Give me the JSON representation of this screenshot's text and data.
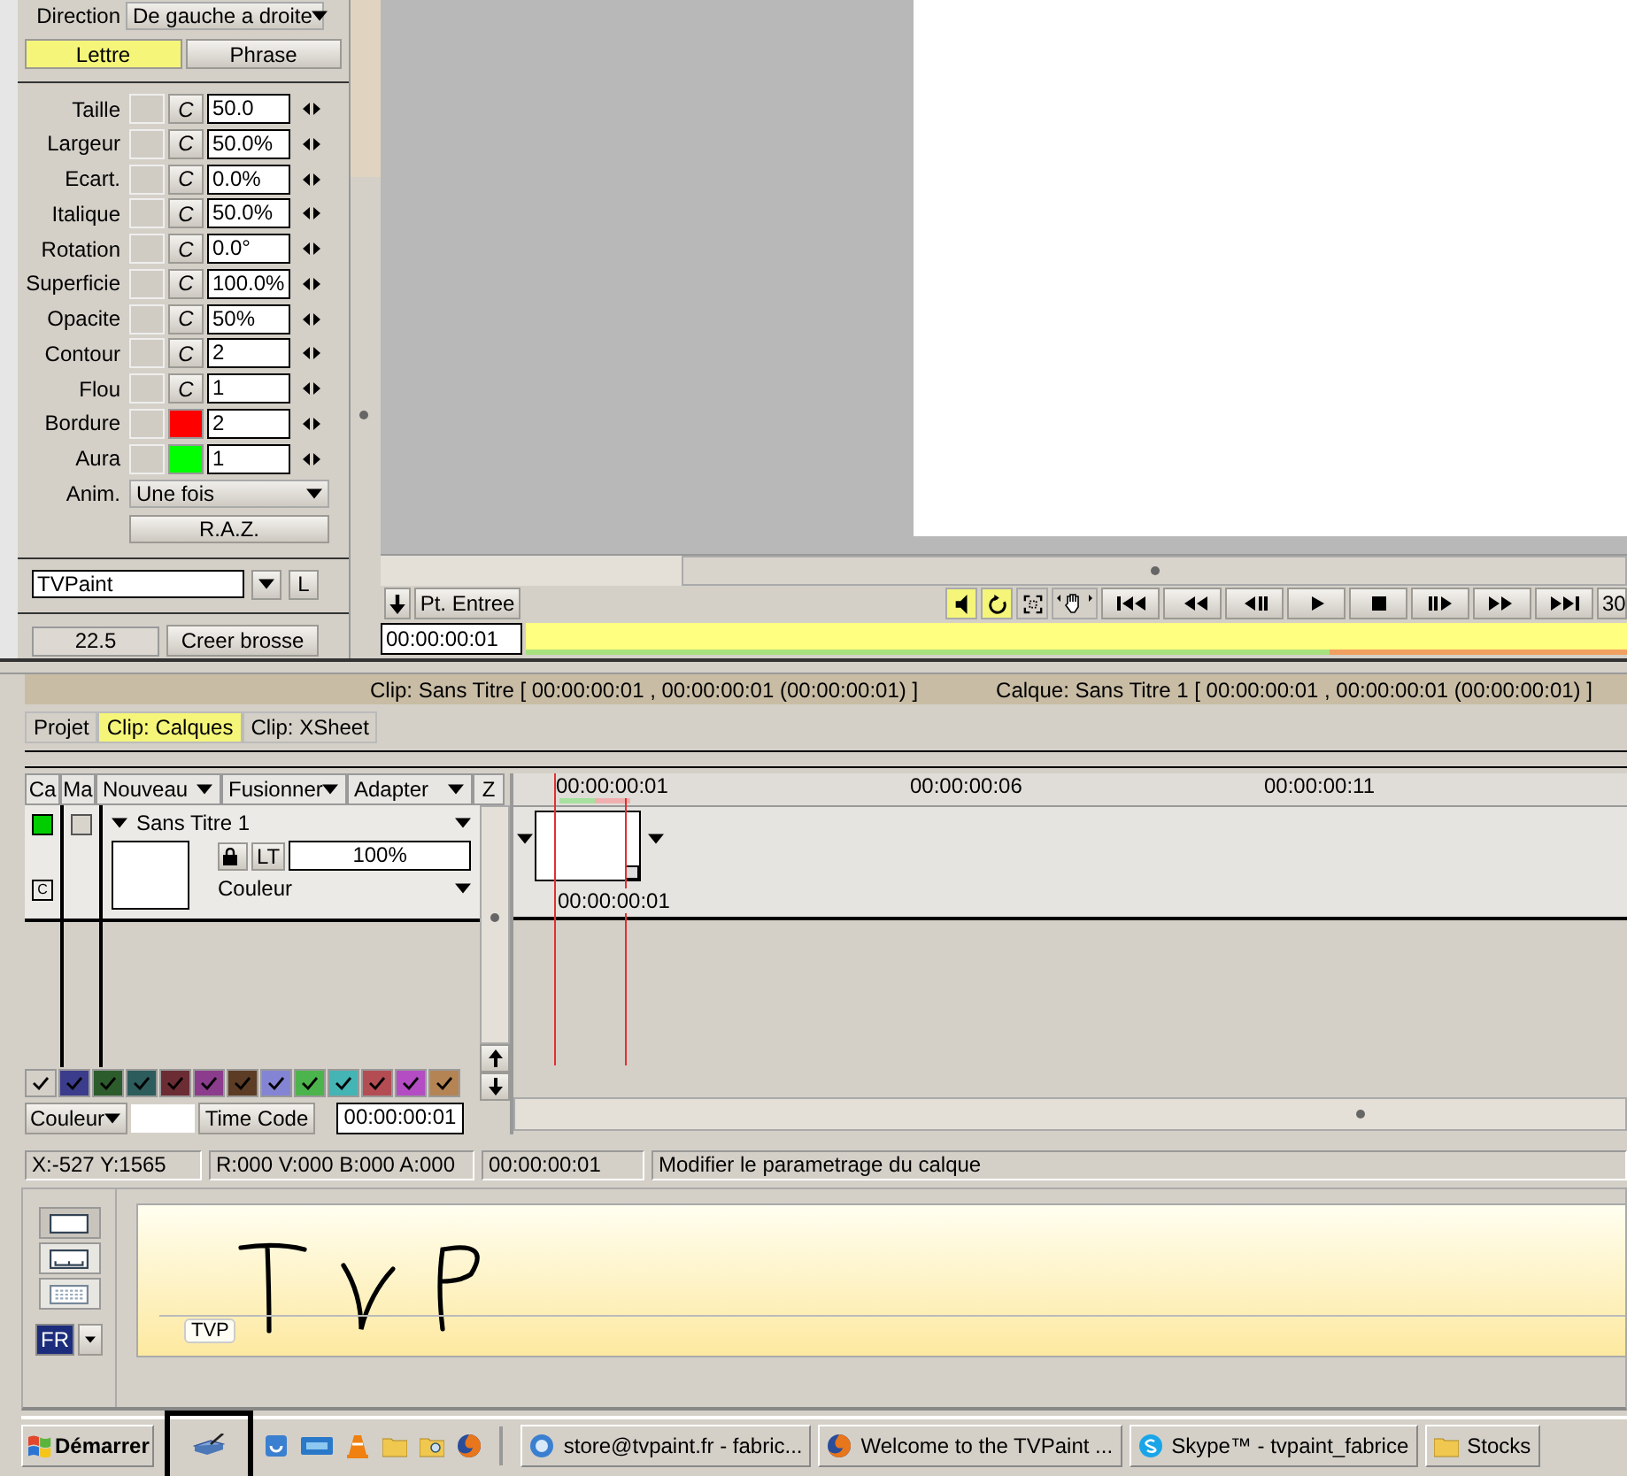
{
  "text_panel": {
    "direction_label": "Direction",
    "direction_value": "De gauche a droite",
    "modes": [
      {
        "label": "Lettre",
        "selected": true
      },
      {
        "label": "Phrase",
        "selected": false
      }
    ],
    "params": [
      {
        "label": "Taille",
        "kind": "reset",
        "reset": "C",
        "value": "50.0"
      },
      {
        "label": "Largeur",
        "kind": "reset",
        "reset": "C",
        "value": "50.0%"
      },
      {
        "label": "Ecart.",
        "kind": "reset",
        "reset": "C",
        "value": "0.0%"
      },
      {
        "label": "Italique",
        "kind": "reset",
        "reset": "C",
        "value": "50.0%"
      },
      {
        "label": "Rotation",
        "kind": "reset",
        "reset": "C",
        "value": "0.0°"
      },
      {
        "label": "Superficie",
        "kind": "reset",
        "reset": "C",
        "value": "100.0%"
      },
      {
        "label": "Opacite",
        "kind": "reset",
        "reset": "C",
        "value": "50%"
      },
      {
        "label": "Contour",
        "kind": "reset",
        "reset": "C",
        "value": "2"
      },
      {
        "label": "Flou",
        "kind": "reset",
        "reset": "C",
        "value": "1"
      },
      {
        "label": "Bordure",
        "kind": "color",
        "color": "#ff0000",
        "value": "2"
      },
      {
        "label": "Aura",
        "kind": "color",
        "color": "#00ff00",
        "value": "1"
      }
    ],
    "anim_label": "Anim.",
    "anim_value": "Une fois",
    "reset_button": "R.A.Z.",
    "font_name": "TVPaint",
    "font_lock": "L",
    "brush_size": "22.5",
    "brush_button": "Creer brosse"
  },
  "player": {
    "in_button": "Pt. Entree",
    "timecode": "00:00:00:01",
    "toggles": [
      {
        "kind": "sound",
        "on": true
      },
      {
        "kind": "loop",
        "on": true
      },
      {
        "kind": "safe-area",
        "on": false
      },
      {
        "kind": "pan",
        "on": false
      }
    ],
    "fps": "30"
  },
  "clip_info": "Clip: Sans Titre [ 00:00:00:01 , 00:00:00:01  (00:00:00:01) ]",
  "layer_info": "Calque: Sans Titre 1 [ 00:00:00:01 , 00:00:00:01  (00:00:00:01) ]",
  "tabs": [
    {
      "label": "Projet",
      "selected": false
    },
    {
      "label": "Clip: Calques",
      "selected": true
    },
    {
      "label": "Clip: XSheet",
      "selected": false
    }
  ],
  "layer_panel": {
    "columns": [
      "Ca",
      "Ma"
    ],
    "menus": [
      "Nouveau",
      "Fusionner",
      "Adapter"
    ],
    "z": "Z",
    "layer": {
      "name": "Sans Titre 1",
      "color": "#00cc00",
      "marked": false,
      "c_mark": "C",
      "lock": "LT",
      "opacity": "100%",
      "blend": "Couleur"
    },
    "swatches": [
      {
        "color": "#d4d0c8"
      },
      {
        "color": "#3c3c8c"
      },
      {
        "color": "#2c5c2c"
      },
      {
        "color": "#2c5c5c"
      },
      {
        "color": "#6c2c34"
      },
      {
        "color": "#8c3c8c"
      },
      {
        "color": "#5c3c24"
      },
      {
        "color": "#8484d4"
      },
      {
        "color": "#4cb44c"
      },
      {
        "color": "#44b4b4"
      },
      {
        "color": "#b44c54"
      },
      {
        "color": "#b44cc4"
      },
      {
        "color": "#b48454"
      }
    ],
    "color_menu": "Couleur",
    "timecode_button": "Time Code",
    "timecode_value": "00:00:00:01"
  },
  "timeline": {
    "ruler": [
      "00:00:00:01",
      "00:00:00:06",
      "00:00:00:11"
    ],
    "clip_label": "00:00:00:01"
  },
  "status_bar": [
    "X:-527  Y:1565",
    "R:000 V:000 B:000 A:000",
    "00:00:00:01",
    "Modifier le parametrage du calque"
  ],
  "handwriting": {
    "tag": "TVP",
    "language": "FR"
  },
  "taskbar": {
    "start": "Démarrer",
    "tasks": [
      {
        "kind": "mail",
        "label": "store@tvpaint.fr - fabric..."
      },
      {
        "kind": "browser",
        "label": "Welcome to the TVPaint ..."
      },
      {
        "kind": "chat",
        "label": "Skype™ - tvpaint_fabrice"
      },
      {
        "kind": "folder",
        "label": "Stocks"
      }
    ]
  }
}
